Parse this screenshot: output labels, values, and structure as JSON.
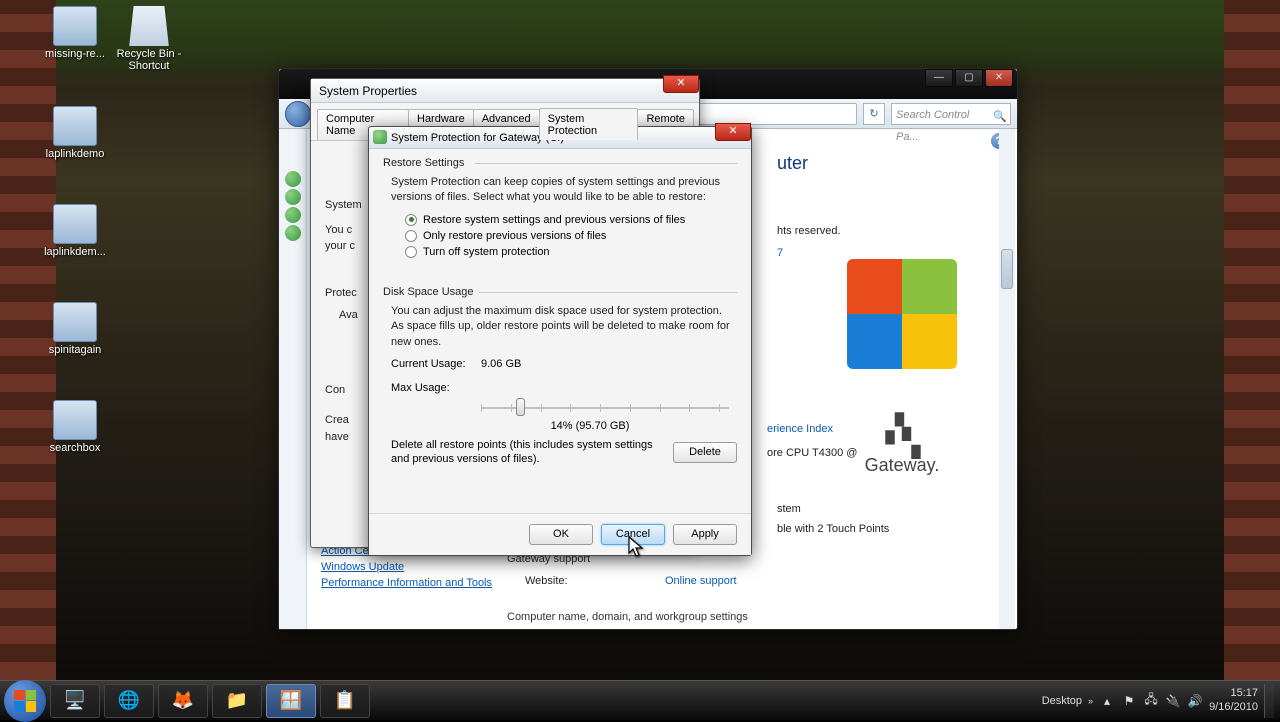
{
  "desktop_icons": [
    {
      "label": "missing-re..."
    },
    {
      "label": "Recycle Bin - Shortcut"
    },
    {
      "label": "laplinkdemo"
    },
    {
      "label": "laplinkdem..."
    },
    {
      "label": "spinitagain"
    },
    {
      "label": "searchbox"
    }
  ],
  "cp": {
    "search_placeholder": "Search Control Pa...",
    "help_icon": "?",
    "heading_frag": "uter",
    "frag_rights": "hts reserved.",
    "frag_seven": "7",
    "frag_exp": "erience Index",
    "frag_cpu": "ore CPU    T4300  @",
    "frag_system": "stem",
    "frag_touch": "ble with 2 Touch Points",
    "support_hdr": "Gateway support",
    "website_lbl": "Website:",
    "website_link": "Online support",
    "bottom_hdr": "Computer name, domain, and workgroup settings",
    "gateway": "Gateway.",
    "seealso": {
      "action": "Action Cent",
      "wu": "Windows Update",
      "perf": "Performance Information and Tools"
    }
  },
  "sp": {
    "title": "System Properties",
    "tabs": [
      "Computer Name",
      "Hardware",
      "Advanced",
      "System Protection",
      "Remote"
    ],
    "text_frag1": "System",
    "text_frag2": "You c",
    "text_frag3": "your c",
    "text_frag4": "Protec",
    "text_frag5": "Ava",
    "text_frag6": "Con",
    "text_frag7": "Crea",
    "text_frag8": "have"
  },
  "prot": {
    "title": "System Protection for Gateway (C:)",
    "restore_hdr": "Restore Settings",
    "restore_txt": "System Protection can keep copies of system settings and previous versions of files. Select what you would like to be able to restore:",
    "opt1": "Restore system settings and previous versions of files",
    "opt2": "Only restore previous versions of files",
    "opt3": "Turn off system protection",
    "disk_hdr": "Disk Space Usage",
    "disk_txt": "You can adjust the maximum disk space used for system protection. As space fills up, older restore points will be deleted to make room for new ones.",
    "current_lbl": "Current Usage:",
    "current_val": "9.06 GB",
    "max_lbl": "Max Usage:",
    "slider_val": "14% (95.70 GB)",
    "delete_txt": "Delete all restore points (this includes system settings and previous versions of files).",
    "delete_btn": "Delete",
    "ok": "OK",
    "cancel": "Cancel",
    "apply": "Apply"
  },
  "taskbar": {
    "desktop_label": "Desktop",
    "time": "15:17",
    "date": "9/16/2010"
  }
}
